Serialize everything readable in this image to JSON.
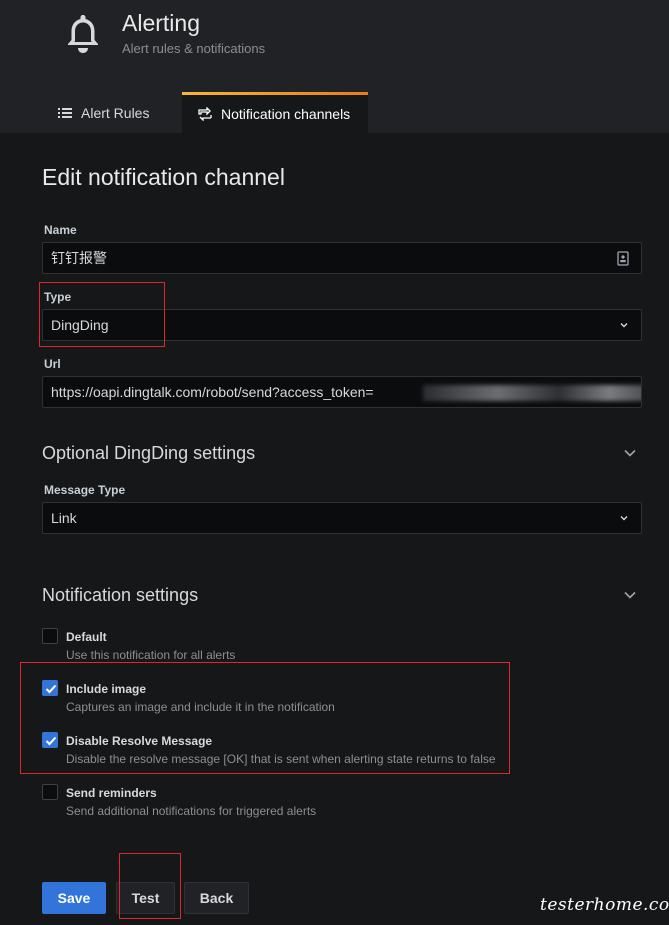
{
  "header": {
    "title": "Alerting",
    "subtitle": "Alert rules & notifications",
    "icon": "bell-icon"
  },
  "tabs": [
    {
      "label": "Alert Rules",
      "icon": "list-icon",
      "active": false
    },
    {
      "label": "Notification channels",
      "icon": "channels-icon",
      "active": true
    }
  ],
  "form": {
    "page_title": "Edit notification channel",
    "name": {
      "label": "Name",
      "value": "钉钉报警"
    },
    "type": {
      "label": "Type",
      "value": "DingDing"
    },
    "url": {
      "label": "Url",
      "value": "https://oapi.dingtalk.com/robot/send?access_token="
    },
    "optional_section": {
      "title": "Optional DingDing settings",
      "message_type": {
        "label": "Message Type",
        "value": "Link"
      }
    },
    "notification_section": {
      "title": "Notification settings",
      "options": [
        {
          "label": "Default",
          "desc": "Use this notification for all alerts",
          "checked": false
        },
        {
          "label": "Include image",
          "desc": "Captures an image and include it in the notification",
          "checked": true
        },
        {
          "label": "Disable Resolve Message",
          "desc": "Disable the resolve message [OK] that is sent when alerting state returns to false",
          "checked": true
        },
        {
          "label": "Send reminders",
          "desc": "Send additional notifications for triggered alerts",
          "checked": false
        }
      ]
    }
  },
  "buttons": {
    "save": "Save",
    "test": "Test",
    "back": "Back"
  },
  "watermark": "testerhome.com",
  "colors": {
    "accent": "#3274d9",
    "annotation": "#e0262d",
    "tab_highlight": "#eb7b18"
  }
}
